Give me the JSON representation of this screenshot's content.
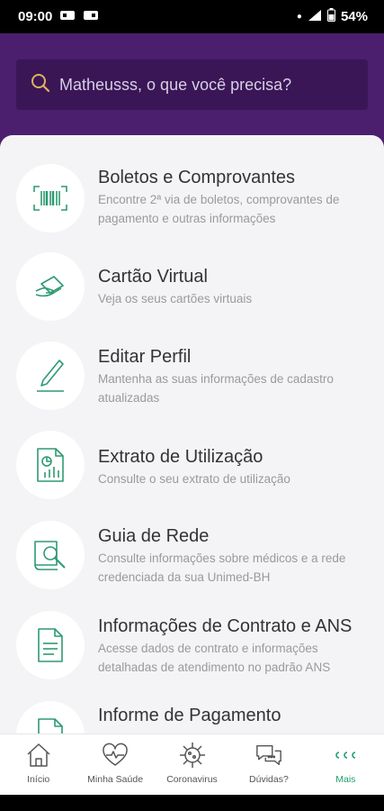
{
  "status_bar": {
    "time": "09:00",
    "battery": "54%"
  },
  "search": {
    "placeholder": "Matheusss, o que você precisa?"
  },
  "menu": [
    {
      "title": "Boletos e Comprovantes",
      "description": "Encontre 2ª via de boletos, comprovantes de pagamento e outras informações",
      "icon": "barcode-icon"
    },
    {
      "title": "Cartão Virtual",
      "description": "Veja os seus cartões virtuais",
      "icon": "card-hand-icon"
    },
    {
      "title": "Editar Perfil",
      "description": "Mantenha as suas informações de cadastro atualizadas",
      "icon": "pen-icon"
    },
    {
      "title": "Extrato de Utilização",
      "description": "Consulte o seu extrato de utilização",
      "icon": "report-chart-icon"
    },
    {
      "title": "Guia de Rede",
      "description": "Consulte informações sobre médicos e a rede credenciada da sua Unimed-BH",
      "icon": "book-search-icon"
    },
    {
      "title": "Informações de Contrato e ANS",
      "description": "Acesse dados de contrato e informações detalhadas de atendimento no padrão ANS",
      "icon": "document-icon"
    },
    {
      "title": "Informe de Pagamento",
      "description": "",
      "icon": "document-icon"
    }
  ],
  "bottom_nav": [
    {
      "label": "Início",
      "icon": "home-icon"
    },
    {
      "label": "Minha Saúde",
      "icon": "heart-pulse-icon"
    },
    {
      "label": "Coronavirus",
      "icon": "virus-icon"
    },
    {
      "label": "Dúvidas?",
      "icon": "chat-bubbles-icon"
    },
    {
      "label": "Mais",
      "icon": "more-icon",
      "active": true
    }
  ],
  "colors": {
    "header": "#4b1f6e",
    "search_bg": "#3a1657",
    "accent": "#1f9e6c",
    "sheet": "#f4f4f7",
    "icon_stroke": "#2e9a72"
  }
}
